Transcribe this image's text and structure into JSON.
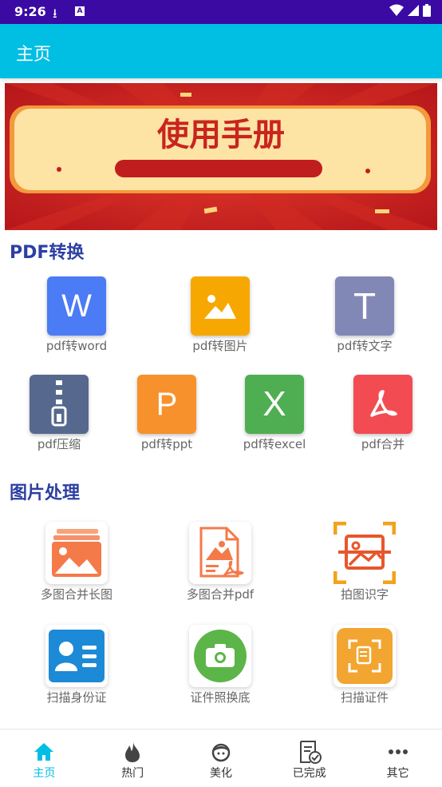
{
  "status_bar": {
    "time": "9:26"
  },
  "app_bar": {
    "title": "主页"
  },
  "banner": {
    "text": "使用手册"
  },
  "sections": {
    "pdf": {
      "title": "PDF转换",
      "items": [
        {
          "label": "pdf转word",
          "glyph": "W",
          "color": "#4b7bf5",
          "icon": "word-icon"
        },
        {
          "label": "pdf转图片",
          "glyph": "",
          "color": "#f7a800",
          "icon": "image-icon"
        },
        {
          "label": "pdf转文字",
          "glyph": "T",
          "color": "#8288b6",
          "icon": "text-icon"
        },
        {
          "label": "pdf压缩",
          "glyph": "",
          "color": "#56688e",
          "icon": "zip-icon"
        },
        {
          "label": "pdf转ppt",
          "glyph": "P",
          "color": "#f7912c",
          "icon": "ppt-icon"
        },
        {
          "label": "pdf转excel",
          "glyph": "X",
          "color": "#4fae51",
          "icon": "excel-icon"
        },
        {
          "label": "pdf合并",
          "glyph": "",
          "color": "#f24c52",
          "icon": "pdf-merge-icon"
        }
      ]
    },
    "image": {
      "title": "图片处理",
      "items": [
        {
          "label": "多图合并长图",
          "icon": "merge-long-image-icon",
          "color": "#f47a4a"
        },
        {
          "label": "多图合并pdf",
          "icon": "merge-pdf-icon",
          "color": "#f47a4a"
        },
        {
          "label": "拍图识字",
          "icon": "photo-ocr-icon",
          "color": "#f2a21b"
        },
        {
          "label": "扫描身份证",
          "icon": "id-card-icon",
          "color": "#1c8ad6"
        },
        {
          "label": "证件照换底",
          "icon": "id-photo-icon",
          "color": "#5cb548"
        },
        {
          "label": "扫描证件",
          "icon": "scan-doc-icon",
          "color": "#f2a531"
        }
      ]
    }
  },
  "bottom_nav": [
    {
      "label": "主页",
      "icon": "home-icon",
      "active": true
    },
    {
      "label": "热门",
      "icon": "flame-icon",
      "active": false
    },
    {
      "label": "美化",
      "icon": "beauty-icon",
      "active": false
    },
    {
      "label": "已完成",
      "icon": "completed-icon",
      "active": false
    },
    {
      "label": "其它",
      "icon": "more-icon",
      "active": false
    }
  ],
  "colors": {
    "accent": "#00bfe3",
    "status_bar": "#3a0aa3",
    "section_title": "#2c3fa2"
  }
}
